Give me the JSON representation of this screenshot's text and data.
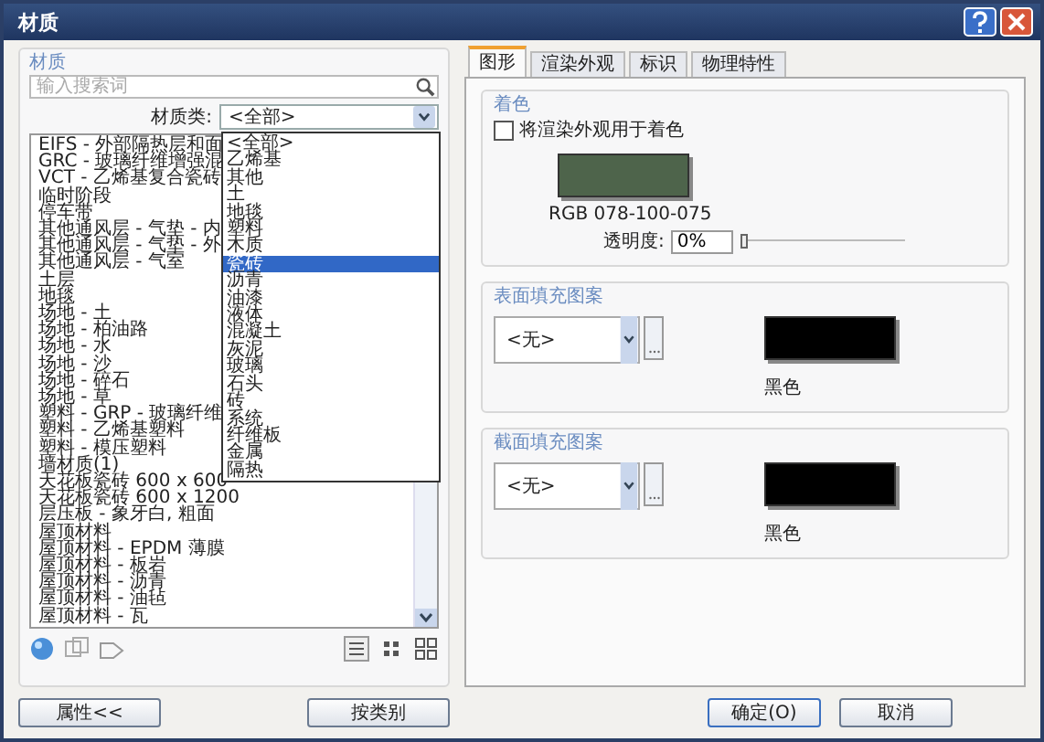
{
  "window": {
    "title": "材质"
  },
  "material_panel": {
    "label": "材质",
    "search": {
      "placeholder": "输入搜索词"
    },
    "class_label": "材质类:",
    "class_value": "<全部>",
    "class_options": [
      {
        "label": "<全部>",
        "selected": false
      },
      {
        "label": "乙烯基",
        "selected": false
      },
      {
        "label": "其他",
        "selected": false
      },
      {
        "label": "土",
        "selected": false
      },
      {
        "label": "地毯",
        "selected": false
      },
      {
        "label": "塑料",
        "selected": false
      },
      {
        "label": "木质",
        "selected": false
      },
      {
        "label": "瓷砖",
        "selected": true
      },
      {
        "label": "沥青",
        "selected": false
      },
      {
        "label": "油漆",
        "selected": false
      },
      {
        "label": "液体",
        "selected": false
      },
      {
        "label": "混凝土",
        "selected": false
      },
      {
        "label": "灰泥",
        "selected": false
      },
      {
        "label": "玻璃",
        "selected": false
      },
      {
        "label": "石头",
        "selected": false
      },
      {
        "label": "砖",
        "selected": false
      },
      {
        "label": "系统",
        "selected": false
      },
      {
        "label": "纤维板",
        "selected": false
      },
      {
        "label": "金属",
        "selected": false
      },
      {
        "label": "隔热",
        "selected": false
      }
    ],
    "materials": [
      "EIFS - 外部隔热层和面",
      "GRC - 玻璃纤维增强混",
      "VCT - 乙烯基复合瓷砖",
      "临时阶段",
      "停车带",
      "其他通风层 - 气垫 - 内",
      "其他通风层 - 气垫 - 外",
      "其他通风层 - 气室",
      "土层",
      "地毯",
      "场地 - 土",
      "场地 - 柏油路",
      "场地 - 水",
      "场地 - 沙",
      "场地 - 碎石",
      "场地 - 草",
      "塑料 - GRP - 玻璃纤维",
      "塑料 - 乙烯基塑料",
      "塑料 - 模压塑料",
      "墙材质(1)",
      "天花板瓷砖 600 x 600",
      "天花板瓷砖 600 x 1200",
      "层压板 - 象牙白, 粗面",
      "屋顶材料",
      "屋顶材料 - EPDM 薄膜",
      "屋顶材料 - 板岩",
      "屋顶材料 - 沥青",
      "屋顶材料 - 油毡",
      "屋顶材料 - 瓦"
    ]
  },
  "left_buttons": [
    "属性<<",
    "按类别"
  ],
  "tabs": [
    {
      "label": "图形",
      "selected": true
    },
    {
      "label": "渲染外观",
      "selected": false
    },
    {
      "label": "标识",
      "selected": false
    },
    {
      "label": "物理特性",
      "selected": false
    }
  ],
  "shading": {
    "title": "着色",
    "use_render": {
      "label": "将渲染外观用于着色",
      "checked": false
    },
    "color": "#4e644b",
    "rgb": "RGB 078-100-075",
    "transparency_label": "透明度:",
    "transparency_value": "0%",
    "transparency": {
      "level": 0
    }
  },
  "patterns": [
    {
      "title": "表面填充图案",
      "pattern": "<无>",
      "color": "#000000",
      "color_name": "黑色"
    },
    {
      "title": "截面填充图案",
      "pattern": "<无>",
      "color": "#000000",
      "color_name": "黑色"
    }
  ],
  "buttons": [
    "确定(O)",
    "取消"
  ]
}
